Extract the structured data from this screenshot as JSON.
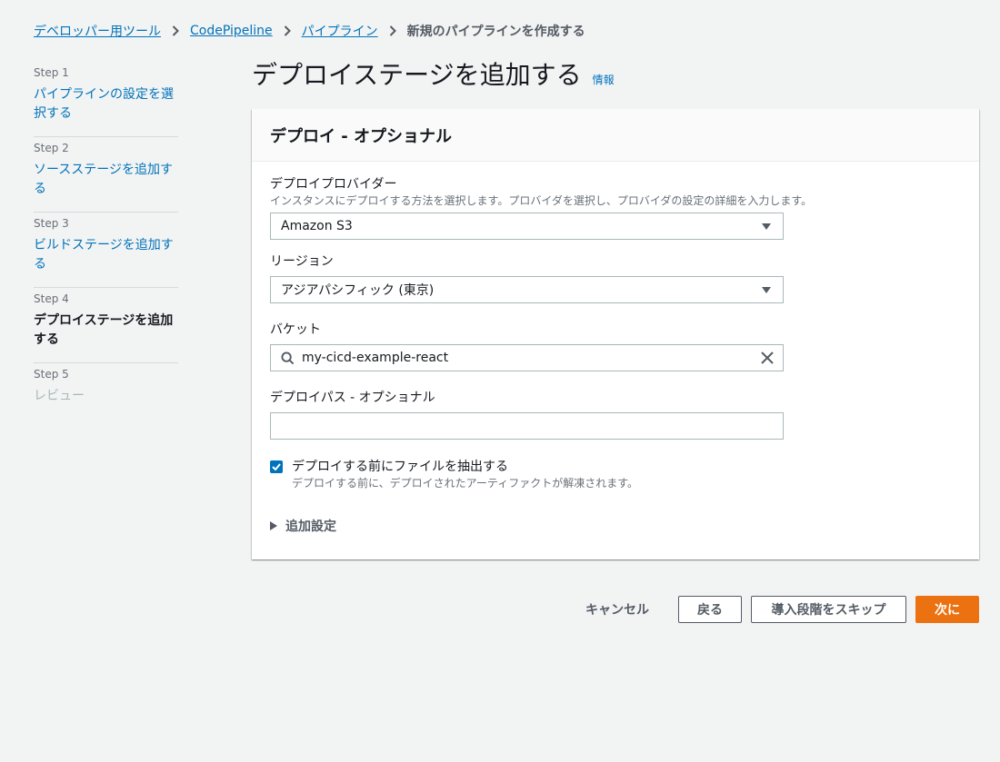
{
  "breadcrumb": {
    "items": [
      "デベロッパー用ツール",
      "CodePipeline",
      "パイプライン"
    ],
    "current": "新規のパイプラインを作成する"
  },
  "steps": [
    {
      "num": "Step 1",
      "title": "パイプラインの設定を選択する",
      "state": "link"
    },
    {
      "num": "Step 2",
      "title": "ソースステージを追加する",
      "state": "link"
    },
    {
      "num": "Step 3",
      "title": "ビルドステージを追加する",
      "state": "link"
    },
    {
      "num": "Step 4",
      "title": "デプロイステージを追加する",
      "state": "current"
    },
    {
      "num": "Step 5",
      "title": "レビュー",
      "state": "disabled"
    }
  ],
  "page": {
    "title": "デプロイステージを追加する",
    "info": "情報"
  },
  "panel": {
    "title": "デプロイ - オプショナル",
    "provider": {
      "label": "デプロイプロバイダー",
      "description": "インスタンスにデプロイする方法を選択します。プロバイダを選択し、プロバイダの設定の詳細を入力します。",
      "value": "Amazon S3"
    },
    "region": {
      "label": "リージョン",
      "value": "アジアパシフィック (東京)"
    },
    "bucket": {
      "label": "バケット",
      "value": "my-cicd-example-react"
    },
    "deploy_path": {
      "label": "デプロイパス - オプショナル",
      "value": ""
    },
    "extract": {
      "label": "デプロイする前にファイルを抽出する",
      "description": "デプロイする前に、デプロイされたアーティファクトが解凍されます。",
      "checked": true
    },
    "additional": {
      "label": "追加設定"
    }
  },
  "actions": {
    "cancel": "キャンセル",
    "back": "戻る",
    "skip": "導入段階をスキップ",
    "next": "次に"
  },
  "colors": {
    "link": "#0073bb",
    "primary": "#ec7211",
    "background": "#f2f3f3"
  }
}
